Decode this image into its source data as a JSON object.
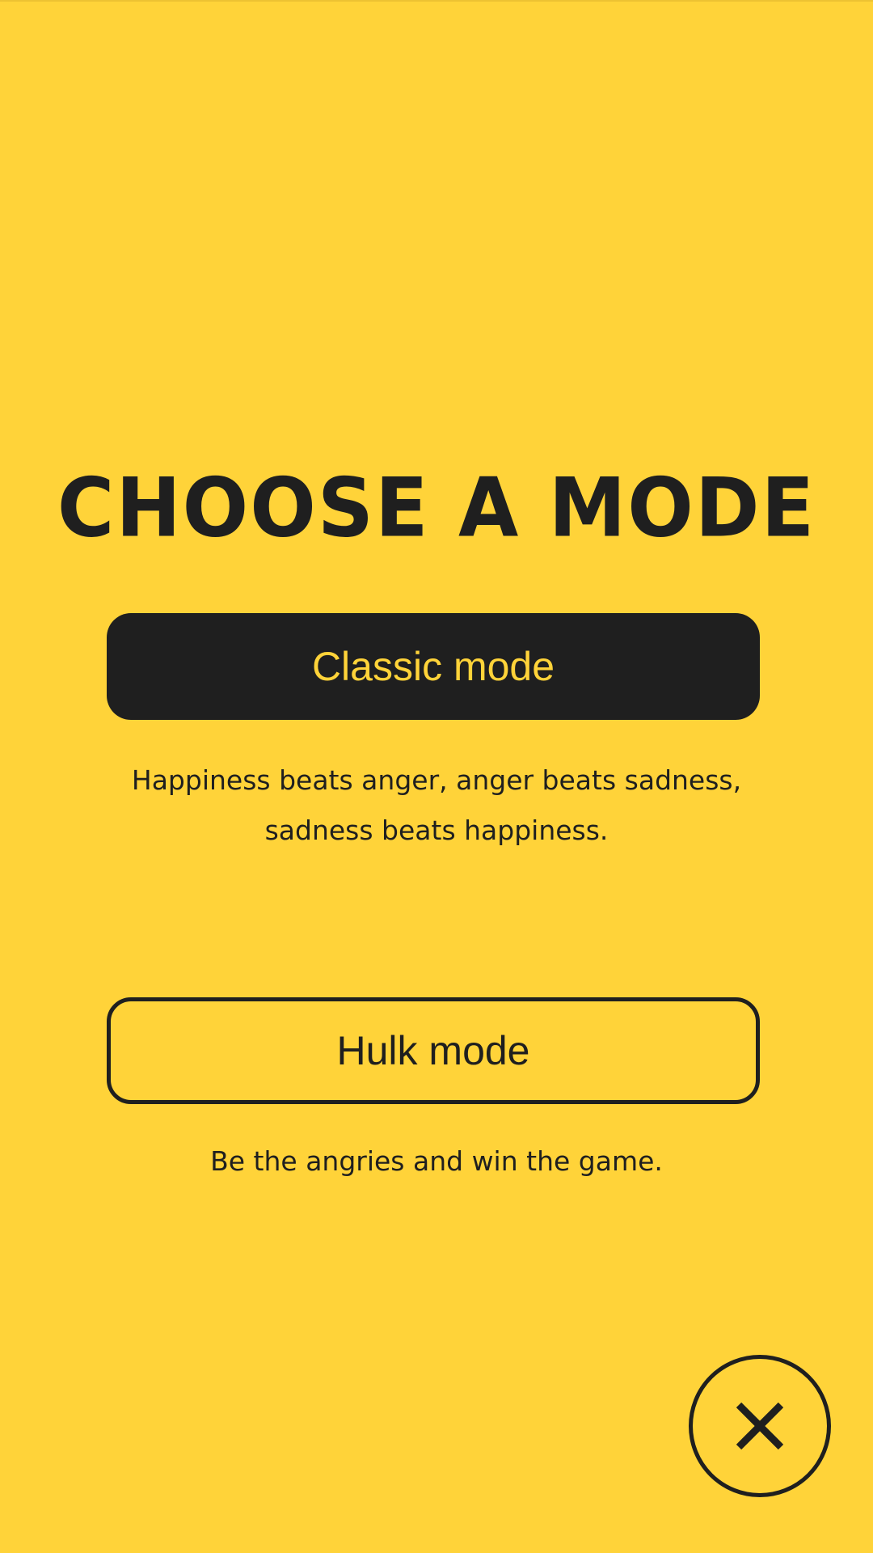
{
  "title": "CHOOSE A MODE",
  "modes": [
    {
      "label": "Classic mode",
      "description": "Happiness beats anger, anger beats sadness, sadness beats happiness.",
      "selected": true
    },
    {
      "label": "Hulk mode",
      "description": "Be the angries and win the game.",
      "selected": false
    }
  ],
  "close": {
    "icon": "close-icon"
  },
  "colors": {
    "background": "#FFD339",
    "foreground": "#1F1F1F"
  }
}
